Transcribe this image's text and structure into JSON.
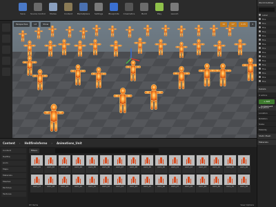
{
  "toolbar": {
    "buttons": [
      {
        "label": "Save",
        "icon": "save-icon",
        "color": "#4a79c8"
      },
      {
        "label": "Source Control",
        "icon": "source-control-icon",
        "color": "#6a6a6a"
      },
      {
        "label": "Modes",
        "icon": "modes-icon",
        "color": "#8aa0c0"
      },
      {
        "label": "Content",
        "icon": "content-icon",
        "color": "#8a7a55"
      },
      {
        "label": "Marketplace",
        "icon": "marketplace-icon",
        "color": "#4a70b0"
      },
      {
        "label": "Settings",
        "icon": "settings-icon",
        "color": "#7a7a7a"
      },
      {
        "label": "Blueprints",
        "icon": "blueprints-icon",
        "color": "#3a6fd0"
      },
      {
        "label": "Cinematics",
        "icon": "cinematics-icon",
        "color": "#555"
      },
      {
        "label": "Build",
        "icon": "build-icon",
        "color": "#6c6c6c"
      },
      {
        "label": "Play",
        "icon": "play-icon",
        "color": "#8fc04a"
      },
      {
        "label": "Launch",
        "icon": "launch-icon",
        "color": "#7a7a7a"
      }
    ]
  },
  "viewport": {
    "perspective_label": "Perspective",
    "lit_label": "Lit",
    "show_label": "Show",
    "grid_value": "10",
    "angle_value": "10°",
    "scale_value": "0.25",
    "speed_value": "4"
  },
  "outliner": {
    "title": "World Outliner",
    "items": [
      "Label",
      "Fire",
      "Fire",
      "Fire",
      "Fire",
      "Fire",
      "Fire",
      "Fire",
      "Fire",
      "Fire",
      "Fire",
      "Fire",
      "Fire",
      "Fire",
      "Fire",
      "Fire",
      "Fire"
    ]
  },
  "details": {
    "title": "Details",
    "actor_count": "0 actors",
    "add_component_label": "+ Add Component",
    "sections": [
      "Transform",
      "Static Mesh",
      "Materials"
    ],
    "transform_rows": [
      "Location",
      "Rotation",
      "Scale",
      "Mobility"
    ]
  },
  "content_browser": {
    "crumbs": [
      "Content",
      "HellfireInferno",
      "Animations_Unit"
    ],
    "filters_label": "Filters",
    "folders": [
      "Content",
      "Hellfire",
      "Anim",
      "Maps",
      "Materials",
      "Meshes",
      "Particles",
      "Textures"
    ],
    "assets": [
      "Anim_01",
      "Anim_02",
      "Anim_03",
      "Anim_04",
      "Anim_05",
      "Anim_06",
      "Anim_07",
      "Anim_08",
      "Anim_09",
      "Anim_10",
      "Anim_11",
      "Anim_12",
      "Anim_13",
      "Anim_14",
      "Anim_15",
      "Anim_16",
      "Anim_17",
      "Anim_18",
      "Anim_19",
      "Anim_20",
      "Anim_21",
      "Anim_22",
      "Anim_23",
      "Anim_24",
      "Anim_25",
      "Anim_26",
      "Anim_27",
      "Anim_28",
      "Anim_29",
      "Anim_30",
      "Anim_31",
      "Anim_32"
    ],
    "status": "63 items",
    "view_options": "View Options"
  }
}
